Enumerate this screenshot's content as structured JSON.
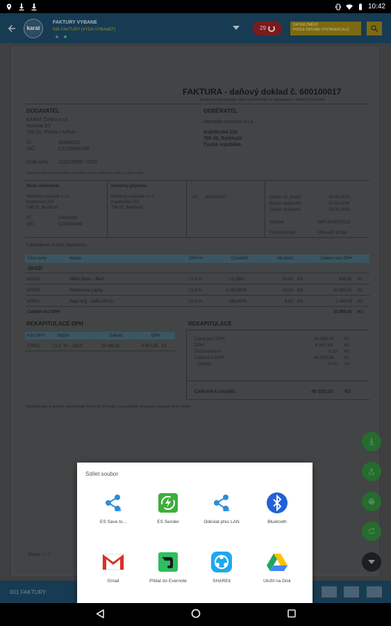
{
  "status_bar": {
    "left_icons": [
      "location-icon",
      "download-icon",
      "download-icon"
    ],
    "right_icons": [
      "vibrate-icon",
      "wifi-icon",
      "battery-icon"
    ],
    "time": "10:42"
  },
  "app_bar": {
    "back_icon": "arrow-left-icon",
    "logo_text": "karat",
    "title": "FAKTURY VYBANE",
    "subtitle": "596 FAKTURY (VYDA VYBANEF)",
    "badge_count": "29",
    "yellow_button_line1": "DATUM ZMĚNY",
    "yellow_button_line2": "PODLE DATUMU VYSTAVENÍ (A-Z)",
    "search_icon": "search-icon"
  },
  "document": {
    "title": "FAKTURA - daňový doklad č. 600100017",
    "subline": "Evidenční číslo dokladu: ZEF V2/2016/00017 a objednávka č. NAZEV/2016/0004",
    "supplier_heading": "DODAVATEL",
    "supplier_lines": [
      "KARAT Česko s.r.o.",
      "Husova 2/2",
      "750 02, Přerov I-Město"
    ],
    "supplier_ic_label": "IČ:",
    "supplier_ic": "60009001",
    "supplier_dic_label": "DIČ:",
    "supplier_dic": "CZ123456789",
    "account_label": "Číslo účtu:",
    "account": "110215385 / 0100",
    "registry_note": "zapsaná v obchodním rejstříku u Krajského soudu v Ostravě v oddíle C, vložce 1000",
    "customer_heading": "ODBĚRATEL",
    "customer_lines": [
      "Hanácký cukrovar s.r.o.",
      "Kojetínská 229",
      "796 02, Bedihošť",
      "Česká republika"
    ],
    "delivery_heading": "Místo odběratele",
    "delivery_lines": [
      "Hanácký cukrovar s.r.o.",
      "Kojetínská 229",
      "796 02, Bedihošť"
    ],
    "delivery_ic_label": "IČ:",
    "delivery_ic": "50859458",
    "delivery_dic_label": "DIČ:",
    "delivery_dic": "CZ50859458",
    "final_recipient_heading": "Konečný příjemce",
    "final_recipient_lines": [
      "Hanácký cukrovar s.r.o.",
      "Kojetínská 229",
      "796 02, Bedihošť"
    ],
    "vs_label": "VS:",
    "vs": "600100017",
    "dates": [
      {
        "label": "Datum zd. plnění:",
        "value": "28.09.2016"
      },
      {
        "label": "Datum splatnosti:",
        "value": "10.10.2016"
      },
      {
        "label": "Datum vystavení:",
        "value": "28.09.2016"
      }
    ],
    "issued_by_label": "Vystavil:",
    "issued_by": "IMPLEMENTACE",
    "payment_label": "Forma úhrady:",
    "payment": "Převodní příkaz",
    "invoice_note": "Fakturujeme za Vaši objednávku:",
    "items_headers": [
      "Číslo karty",
      "Název",
      "DPH %",
      "Cena/MJ",
      "Množství",
      "",
      "Celkem bez DPH",
      ""
    ],
    "items_group": "ZBOŽÍ",
    "items": [
      {
        "code": "KG002",
        "name": "Mléko Basic - Beef",
        "vat": "21,0 %",
        "price": "12,0000",
        "qty": "50,00",
        "unit": "KS",
        "total": "600,00",
        "cur": "Kč"
      },
      {
        "code": "KP005",
        "name": "Pohlednice papíry",
        "vat": "21,0 %",
        "price": "3 080,0000",
        "qty": "10,00",
        "unit": "KS",
        "total": "30 800,00",
        "cur": "Kč"
      },
      {
        "code": "KP001",
        "name": "Papír krtý - balík 100 ks",
        "vat": "21,0 %",
        "price": "288,0000",
        "qty": "5,00",
        "unit": "KS",
        "total": "1 440,00",
        "cur": "Kč"
      }
    ],
    "items_total_label": "Celkem bez DPH",
    "items_total": "33 085,00",
    "items_total_cur": "Kč",
    "vat_recap_heading": "REKAPITULACE DPH",
    "vat_recap_headers": [
      "Kód DPH",
      "Sazba",
      "Základ",
      "DPH"
    ],
    "vat_recap_rows": [
      {
        "code": "P7R21",
        "rate": "21,0",
        "pct": "%",
        "kind": "Zboží",
        "base": "33 085,00",
        "vat": "6 947,85",
        "cur": "Kč"
      }
    ],
    "recap_heading": "REKAPITULACE",
    "recap_rows": [
      {
        "label": "Cena bez DPH:",
        "value": "33 085,00",
        "cur": "Kč"
      },
      {
        "label": "DPH:",
        "value": "6 947,85",
        "cur": "Kč"
      },
      {
        "label": "Zaokrouhlení:",
        "value": "0,15",
        "cur": "Kč"
      },
      {
        "label": "Celkem s DPH:",
        "value": "40 033,00",
        "cur": "Kč"
      },
      {
        "label": "- Zálohy:",
        "value": "0,00",
        "cur": "Kč"
      }
    ],
    "amount_due_label": "Celkově k úhradě:",
    "amount_due": "40 033,00",
    "amount_due_cur": "Kč",
    "footer_note": "Zboží/služby si prosím zkontrolujte ihned do 24 hodin, na pozdější reklamace nebude brán zřetel.",
    "page_label": "Strana: 1 / 1"
  },
  "fabs": [
    "download-icon",
    "share-icon",
    "print-icon",
    "refresh-icon",
    "chevron-down-icon"
  ],
  "bottom_bar": {
    "label": "001 FAKTURY"
  },
  "share_dialog": {
    "title": "Sdílet soubor",
    "apps": [
      {
        "label": "ES Save to...",
        "icon": "es-save-icon",
        "color": "#2b8ed8"
      },
      {
        "label": "ES Sender",
        "icon": "es-sender-icon",
        "color": "#3dae3b"
      },
      {
        "label": "Odeslat přes LAN",
        "icon": "lan-share-icon",
        "color": "#2b8ed8"
      },
      {
        "label": "Bluetooth",
        "icon": "bluetooth-icon",
        "color": "#2161d6"
      },
      {
        "label": "Gmail",
        "icon": "gmail-icon",
        "color": "#d93025"
      },
      {
        "label": "Přidat do Evernote",
        "icon": "evernote-icon",
        "color": "#2dbe60"
      },
      {
        "label": "SHAREit",
        "icon": "shareit-icon",
        "color": "#1ea8f0"
      },
      {
        "label": "Uložit na Disk",
        "icon": "drive-icon",
        "color": "#1fa463"
      }
    ]
  },
  "nav_bar": {
    "back_icon": "nav-back-icon",
    "home_icon": "nav-home-icon",
    "recents_icon": "nav-recents-icon"
  }
}
